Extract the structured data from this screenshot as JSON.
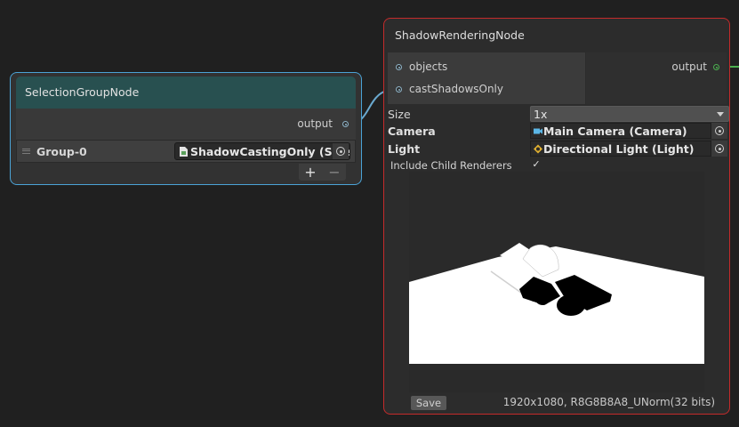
{
  "selection_node": {
    "title": "SelectionGroupNode",
    "output_label": "output",
    "group": {
      "label": "Group-0",
      "value": "ShadowCastingOnly (Sele"
    },
    "add_label": "+",
    "remove_label": "−"
  },
  "shadow_node": {
    "title": "ShadowRenderingNode",
    "inputs": [
      "objects",
      "castShadowsOnly"
    ],
    "output_label": "output",
    "properties": {
      "size_label": "Size",
      "size_value": "1x",
      "camera_label": "Camera",
      "camera_value": "Main Camera (Camera)",
      "light_label": "Light",
      "light_value": "Directional Light (Light)",
      "include_label": "Include Child Renderers",
      "include_checked": "✓"
    },
    "save_label": "Save",
    "resolution": "1920x1080, R8G8B8A8_UNorm(32 bits)"
  },
  "colors": {
    "selection_border": "#4ba3d6",
    "selection_header": "#285050",
    "shadow_border": "#c42b2b",
    "output_port_active": "#4caf50",
    "wire": "#6aa9cf"
  },
  "icons": [
    "drag-handle-icon",
    "selection-asset-icon",
    "object-picker-icon",
    "camera-icon",
    "light-icon",
    "dropdown-caret-icon",
    "checkmark-icon"
  ]
}
